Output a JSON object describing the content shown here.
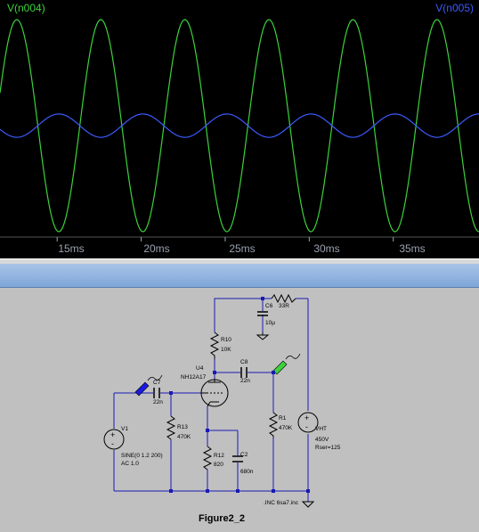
{
  "plot": {
    "trace_left": "V(n004)",
    "trace_right": "V(n005)",
    "colors": {
      "background": "#000000",
      "trace_1": "#3cd23c",
      "trace_2": "#3c5aff",
      "grid": "#2a2a2a",
      "tick_text": "#9aa2b0"
    },
    "x_ticks": [
      "15ms",
      "20ms",
      "25ms",
      "30ms",
      "35ms"
    ]
  },
  "chart_data": {
    "type": "line",
    "x_unit": "ms",
    "x_range": [
      11.6,
      40.1
    ],
    "series": [
      {
        "name": "V(n004)",
        "kind": "sine",
        "frequency_hz": 200,
        "amplitude_norm": 1.0,
        "peak_x_ms": 12.6
      },
      {
        "name": "V(n005)",
        "kind": "sine",
        "frequency_hz": 200,
        "amplitude_norm": 0.11,
        "peak_x_ms": 10.1
      }
    ]
  },
  "schematic": {
    "title": "Figure2_2",
    "components": {
      "c6": {
        "name": "C6",
        "value": "10µ"
      },
      "l_top": {
        "name": "",
        "value": "33R"
      },
      "r10": {
        "name": "R10",
        "value": "10K"
      },
      "u4": {
        "name": "U4",
        "value": "NH12A17"
      },
      "c8": {
        "name": "C8",
        "value": "22n"
      },
      "c7": {
        "name": "C7",
        "value": "22n"
      },
      "r1": {
        "name": "R1",
        "value": "470K"
      },
      "r13": {
        "name": "R13",
        "value": "470K"
      },
      "v1": {
        "name": "V1",
        "line1": "SINE(0 1.2 200)",
        "line2": "AC 1.0"
      },
      "r12": {
        "name": "R12",
        "value": "820"
      },
      "c2": {
        "name": "C2",
        "value": "680n"
      },
      "vht": {
        "name": "VHT",
        "line1": "450V",
        "line2": "Rser=125"
      }
    },
    "directive": ".INC 6sa7.inc"
  }
}
